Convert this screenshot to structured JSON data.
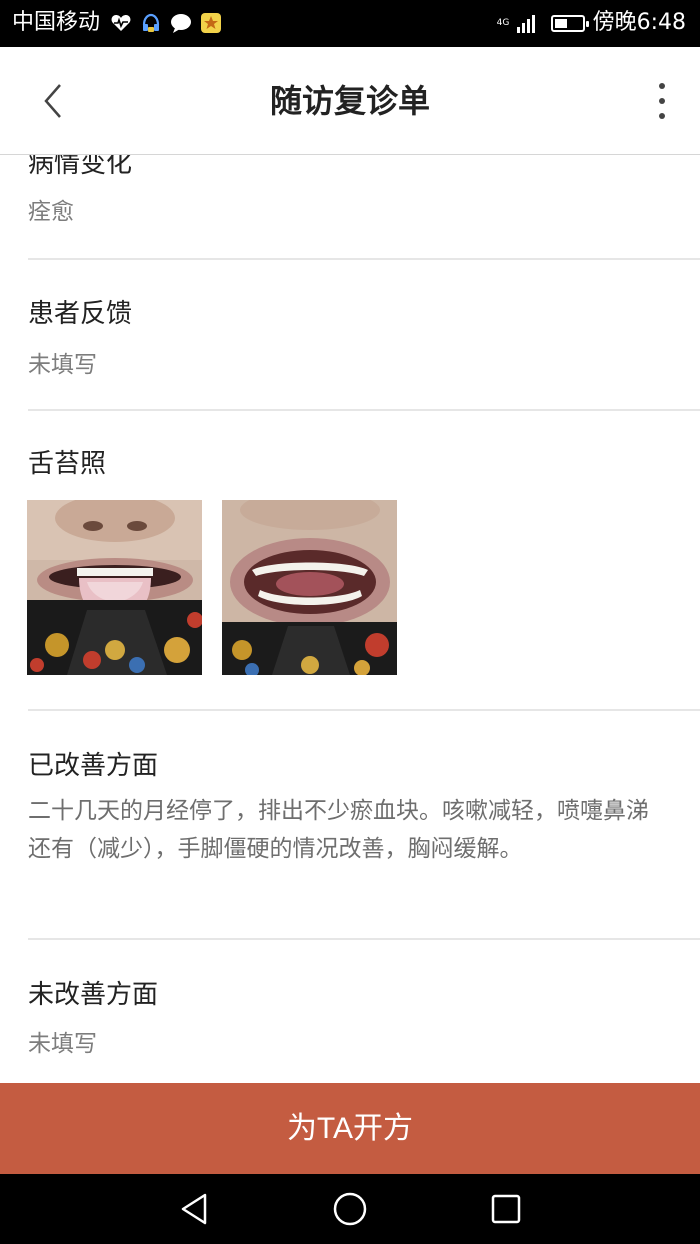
{
  "status_bar": {
    "carrier": "中国移动",
    "network": "4G",
    "time": "傍晚6:48",
    "icons": [
      "heart-rate-icon",
      "headset-icon",
      "chat-bubble-icon",
      "star-app-icon"
    ]
  },
  "header": {
    "title": "随访复诊单",
    "back_icon": "chevron-left-icon",
    "more_icon": "more-vertical-icon"
  },
  "sections": [
    {
      "title": "病情变化",
      "value": "痊愈"
    },
    {
      "title": "患者反馈",
      "value": "未填写"
    },
    {
      "title": "舌苔照",
      "photos": [
        "tongue-photo",
        "mouth-photo"
      ]
    },
    {
      "title": "已改善方面",
      "value": "二十几天的月经停了，排出不少瘀血块。咳嗽减轻，喷嚏鼻涕还有（减少），手脚僵硬的情况改善，胸闷缓解。"
    },
    {
      "title": "未改善方面",
      "value": "未填写"
    }
  ],
  "action": {
    "label": "为TA开方"
  },
  "nav_bar": {
    "icons": [
      "back-triangle-icon",
      "home-circle-icon",
      "recents-square-icon"
    ]
  },
  "colors": {
    "accent": "#c45c41",
    "divider": "#e6e6e6",
    "secondary_text": "#7d7d7d"
  }
}
